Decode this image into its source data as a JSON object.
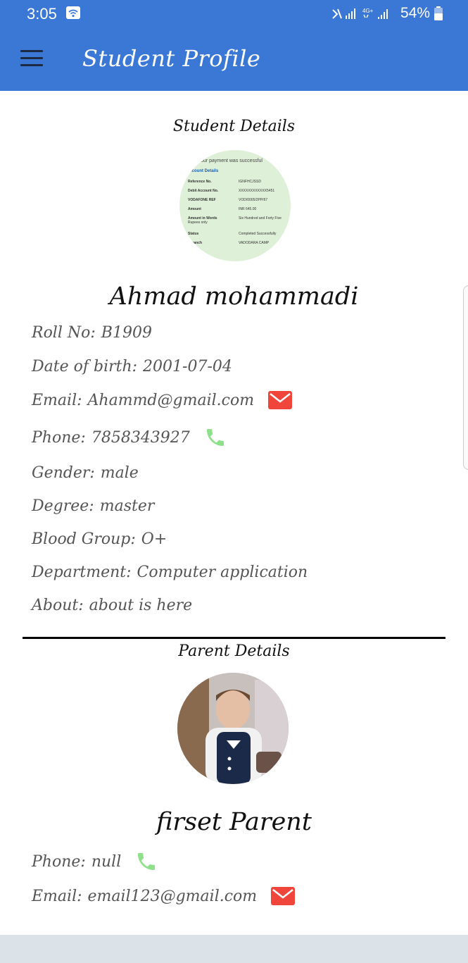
{
  "status_bar": {
    "time": "3:05",
    "battery": "54%"
  },
  "app_bar": {
    "title": "Student Profile",
    "menu_icon": "menu-icon"
  },
  "student": {
    "heading": "Student Details",
    "avatar_receipt": {
      "title": "Your payment was successful",
      "section": "Account Details",
      "rows": [
        {
          "k": "Reference No.",
          "v": "IGNFHCJSSD"
        },
        {
          "k": "Debit Account No.",
          "v": "XXXXXXXXXXXX5451"
        },
        {
          "k": "VODAFONE REF",
          "v": "VOD/0005/2PP/67"
        },
        {
          "k": "Amount",
          "v": "INR 645.00"
        },
        {
          "k": "Amount in Words",
          "v": "Six Hundred and Forty Five Rupees only"
        },
        {
          "k": "Status",
          "v": "Completed Successfully"
        },
        {
          "k": "l Branch",
          "v": "VADODARA CAMP"
        }
      ]
    },
    "name": "Ahmad mohammadi",
    "fields": [
      {
        "label": "Roll No:",
        "value": "B1909"
      },
      {
        "label": "Date of birth:",
        "value": "2001-07-04"
      },
      {
        "label": "Email:",
        "value": "Ahammd@gmail.com",
        "icon": "mail-icon"
      },
      {
        "label": "Phone:",
        "value": "7858343927",
        "icon": "phone-icon"
      },
      {
        "label": "Gender:",
        "value": "male"
      },
      {
        "label": "Degree:",
        "value": "master"
      },
      {
        "label": "Blood Group:",
        "value": "O+"
      },
      {
        "label": "Department:",
        "value": "Computer application"
      },
      {
        "label": "About:",
        "value": "about is here"
      }
    ]
  },
  "parent": {
    "heading": "Parent Details",
    "name": "firset Parent",
    "fields": [
      {
        "label": "Phone:",
        "value": "null",
        "icon": "phone-icon"
      },
      {
        "label": "Email:",
        "value": "email123@gmail.com",
        "icon": "mail-icon"
      }
    ]
  },
  "colors": {
    "app_bar": "#3b78d6",
    "mail_icon": "#f0453a",
    "phone_icon": "#8ee08a",
    "divider": "#000000"
  }
}
